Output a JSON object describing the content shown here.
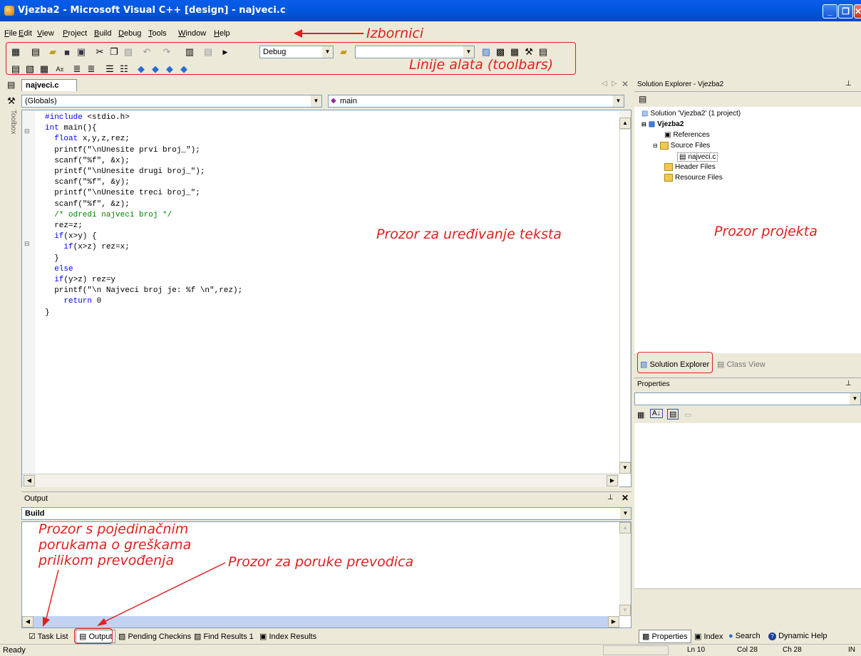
{
  "window": {
    "title": "Vjezba2 - Microsoft Visual C++ [design] - najveci.c",
    "min": "_",
    "max": "❐",
    "close": "✕"
  },
  "menu": {
    "items": [
      {
        "acc": "F",
        "rest": "ile"
      },
      {
        "acc": "E",
        "rest": "dit"
      },
      {
        "acc": "V",
        "rest": "iew"
      },
      {
        "acc": "P",
        "rest": "roject"
      },
      {
        "acc": "B",
        "rest": "uild"
      },
      {
        "acc": "D",
        "rest": "ebug"
      },
      {
        "acc": "T",
        "rest": "ools"
      },
      {
        "acc": "W",
        "rest": "indow"
      },
      {
        "acc": "H",
        "rest": "elp"
      }
    ]
  },
  "toolbar": {
    "config": "Debug",
    "find_value": ""
  },
  "editor": {
    "tab": "najveci.c",
    "scope": "(Globals)",
    "member": "main",
    "toolbox_label": "Toolbox",
    "lines": [
      "#include <stdio.h>",
      "int main(){",
      "  float x,y,z,rez;",
      "  printf(\"\\nUnesite prvi broj_\");",
      "  scanf(\"%f\", &x);",
      "  printf(\"\\nUnesite drugi broj_\");",
      "  scanf(\"%f\", &y);",
      "  printf(\"\\nUnesite treci broj_\";",
      "  scanf(\"%f\", &z);",
      "  /* odredi najveci broj */",
      "  rez=z;",
      "  if(x>y) {",
      "    if(x>z) rez=x;",
      "  }",
      "  else",
      "  if(y>z) rez=y",
      "  printf(\"\\n Najveci broj je: %f \\n\",rez);",
      "    return 0",
      "}"
    ]
  },
  "solution": {
    "title": "Solution Explorer - Vjezba2",
    "solution": "Solution 'Vjezba2' (1 project)",
    "project": "Vjezba2",
    "references": "References",
    "source_files": "Source Files",
    "file": "najveci.c",
    "header_files": "Header Files",
    "resource_files": "Resource Files",
    "tab_solution": "Solution Explorer",
    "tab_class": "Class View"
  },
  "properties": {
    "title": "Properties"
  },
  "output": {
    "title": "Output",
    "combo": "Build",
    "tabs": [
      "Task List",
      "Output",
      "Pending Checkins",
      "Find Results 1",
      "Index Results"
    ]
  },
  "right_bottom_tabs": [
    "Properties",
    "Index",
    "Search",
    "Dynamic Help"
  ],
  "status": {
    "text": "Ready",
    "ln": "Ln 10",
    "col": "Col 28",
    "ch": "Ch 28",
    "ins": "IN"
  },
  "annotations": {
    "menus": "Izbornici",
    "toolbars": "Linije alata (toolbars)",
    "editor": "Prozor za uređivanje teksta",
    "project": "Prozor projekta",
    "messages": "Prozor s pojedinačnim\nporukama o greškama\nprilikom prevođenja",
    "compiler": "Prozor za poruke prevodica"
  },
  "colors": {
    "accent": "#0a5ce8",
    "annotation": "#e02020",
    "keyword": "#0000ff",
    "comment": "#008000"
  }
}
